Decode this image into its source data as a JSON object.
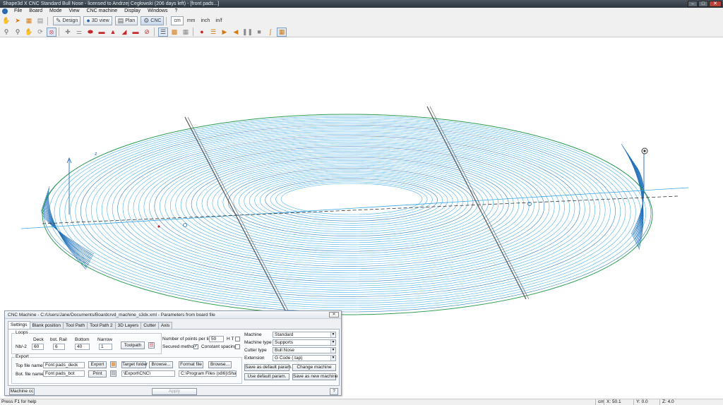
{
  "window": {
    "title": "Shape3d X CNC Standard Bull Nose - licensed to Andrzej Cegłowski (206 days left) - [front pads...]",
    "minimize": "–",
    "maximize": "□",
    "close": "✕"
  },
  "menu": {
    "items": [
      "File",
      "Board",
      "Mode",
      "View",
      "CNC machine",
      "Display",
      "Windows",
      "?"
    ],
    "mdi_minimize": "_",
    "mdi_restore": "❐",
    "mdi_close": "x"
  },
  "toolbar": {
    "modes": [
      {
        "label": "Design",
        "icon": "pencil-icon"
      },
      {
        "label": "3D view",
        "icon": "globe-icon"
      },
      {
        "label": "Plan",
        "icon": "plan-icon"
      },
      {
        "label": "CNC",
        "icon": "cnc-machine-icon"
      }
    ],
    "active_mode": "CNC",
    "units": [
      "cm",
      "mm",
      "inch",
      "in/f"
    ],
    "active_unit": "cm"
  },
  "viewport": {
    "axis_label": "z",
    "colors": {
      "toolpath": "#3aa7e6",
      "toolpath_dark": "#1f6fb8",
      "outline_green": "#2f9e54",
      "section_line": "#555555"
    }
  },
  "dialog": {
    "title": "CNC Machine - C:/Users/Jane/Documents/Boardcrvd_machine_s3dx.xml - Parameters from board file",
    "close": "✕",
    "tabs": [
      "Settings",
      "Blank position",
      "Tool Path",
      "Tool Path 2",
      "3D Layers",
      "Cutter",
      "Axis"
    ],
    "active_tab": "Settings",
    "loops": {
      "group_label": "Loops",
      "nb_label": "Nb/-2",
      "deck_label": "Deck",
      "deck_value": "60",
      "bot_rail_label": "bot. Rail",
      "bot_rail_value": "6",
      "bottom_label": "Bottom",
      "bottom_value": "40",
      "narrow_label": "Narrow",
      "narrow_value": "1",
      "toolpath_button": "Toolpath",
      "points_label": "Number of points per line",
      "points_value": "50",
      "ht_label": "H T",
      "secured_label": "Secured method",
      "secured_checked": "✓",
      "constant_label": "Constant spacing"
    },
    "export": {
      "group_label": "Export",
      "top_file_label": "Top file name",
      "top_file_value": "Font pads_deck",
      "export_button": "Export",
      "bot_file_label": "Bot. file name",
      "bot_file_value": "Font pads_bot",
      "print_button": "Print",
      "target_folder_button": "Target folder",
      "browse_button_1": "Browse...",
      "target_folder_value": "\\Export\\CNC\\",
      "format_file_button": "Format file",
      "browse_button_2": "Browse...",
      "format_file_value": "C:\\Program Files (x86)\\Shape"
    },
    "machine": {
      "machine_label": "Machine",
      "machine_value": "Standard",
      "machine_type_label": "Machine type",
      "machine_type_value": "Supports",
      "cutter_type_label": "Cutter type",
      "cutter_type_value": "Bull Nose",
      "extension_label": "Extension",
      "extension_value": "G Code (.tap)",
      "save_default_button": "Save as default param.",
      "change_machine_button": "Change machine",
      "use_default_button": "Use default param.",
      "save_new_machine_button": "Save as new machine"
    },
    "footer": {
      "machine_button": "Machine cc",
      "apply_button": "Apply",
      "help_button": "?"
    }
  },
  "status": {
    "help": "Press F1 for help",
    "unit": "cm",
    "x": "X: 50.1",
    "y": "Y: 0.0",
    "z": "Z: 4.0"
  }
}
